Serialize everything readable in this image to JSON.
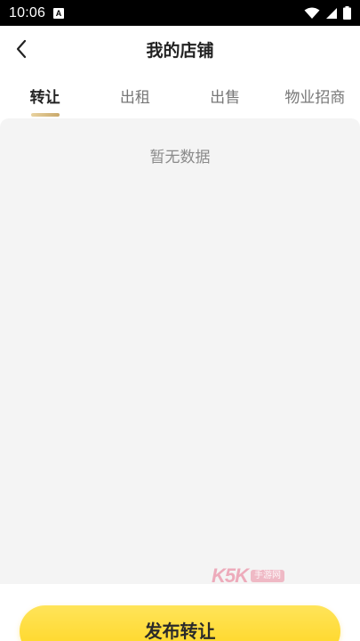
{
  "status_bar": {
    "time": "10:06",
    "notification_icon": "A",
    "icons": [
      "wifi-icon",
      "signal-icon",
      "battery-icon"
    ]
  },
  "nav": {
    "title": "我的店铺",
    "back_icon": "chevron-left-icon"
  },
  "tabs": [
    {
      "label": "转让",
      "active": true
    },
    {
      "label": "出租",
      "active": false
    },
    {
      "label": "出售",
      "active": false
    },
    {
      "label": "物业招商",
      "active": false
    }
  ],
  "content": {
    "empty_text": "暂无数据"
  },
  "watermark": {
    "logo": "K5K",
    "badge": "手游网"
  },
  "publish_button": {
    "label": "发布转让"
  },
  "colors": {
    "accent_yellow": "#ffd51f",
    "tab_indicator": "#d6b87e",
    "content_bg": "#f4f4f4",
    "status_bar_bg": "#000000"
  }
}
